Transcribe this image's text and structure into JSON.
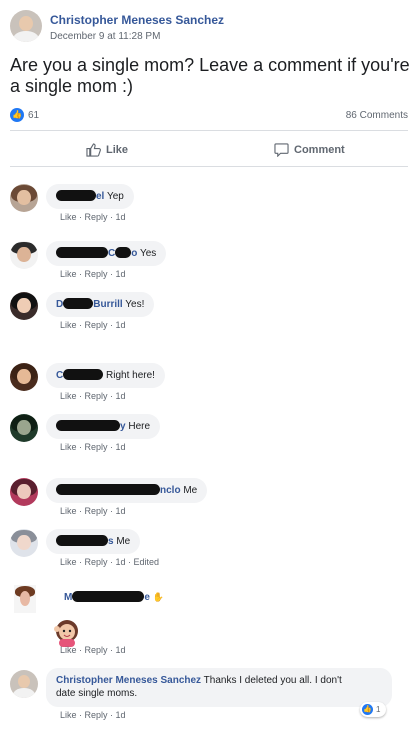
{
  "post": {
    "author": "Christopher Meneses Sanchez",
    "time": "December 9 at 11:28 PM",
    "text": "Are you a single mom? Leave a comment if you're a single mom :)",
    "like_count": "61",
    "comment_count": "86 Comments",
    "like_label": "Like",
    "comment_label": "Comment"
  },
  "meta": {
    "like": "Like",
    "reply": "Reply",
    "sep": " · ",
    "age": "1d",
    "edited": "Edited"
  },
  "comments": [
    {
      "author_visible": "el",
      "text": "Yep"
    },
    {
      "author_visible": "C",
      "author_visible_2": "o",
      "text": "Yes"
    },
    {
      "author_visible": "D",
      "author_visible_2": "Burrill",
      "text": "Yes!"
    },
    {
      "author_visible": "C",
      "text": "Right here!"
    },
    {
      "author_visible": "y",
      "text": "Here"
    },
    {
      "author_visible": "nclo",
      "text": "Me"
    },
    {
      "author_visible": "s",
      "text": "Me"
    },
    {
      "author_visible": "M",
      "author_visible_2": "e",
      "text": ""
    },
    {
      "author": "Christopher Meneses Sanchez",
      "text_line1": "Thanks I deleted you all. I don't",
      "text_line2": "date single moms.",
      "reaction_count": "1"
    }
  ],
  "colors": {
    "link": "#365899",
    "like_blue": "#2078f4",
    "bubble_bg": "#f2f3f5",
    "meta_grey": "#606770"
  }
}
